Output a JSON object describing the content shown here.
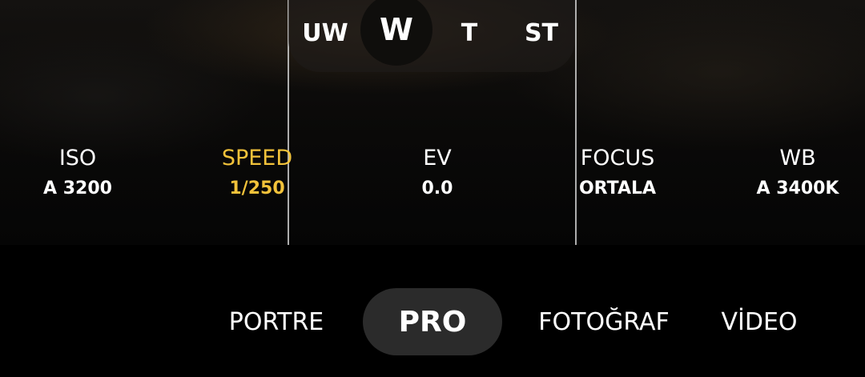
{
  "zoom": {
    "options": [
      "UW",
      "W",
      "T",
      "ST"
    ],
    "selected": "W"
  },
  "pro_params": [
    {
      "label": "ISO",
      "value": "A 3200"
    },
    {
      "label": "SPEED",
      "value": "1/250"
    },
    {
      "label": "EV",
      "value": "0.0"
    },
    {
      "label": "FOCUS",
      "value": "ORTALA"
    },
    {
      "label": "WB",
      "value": "A 3400K"
    }
  ],
  "selected_param": "SPEED",
  "modes": [
    "PORTRE",
    "PRO",
    "FOTOĞRAF",
    "VİDEO"
  ],
  "selected_mode": "PRO",
  "colors": {
    "accent": "#f2c23a",
    "selected_mode_bg": "#2b2b2b",
    "background": "#000000"
  }
}
